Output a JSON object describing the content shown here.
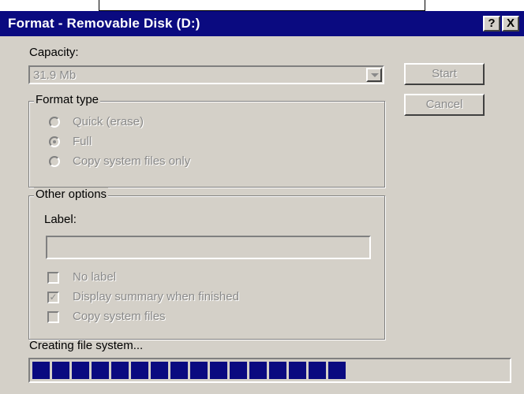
{
  "window": {
    "title": "Format - Removable Disk (D:)",
    "help_button": "?",
    "close_button": "X"
  },
  "capacity": {
    "label": "Capacity:",
    "value": "31.9 Mb"
  },
  "buttons": {
    "start": "Start",
    "cancel": "Cancel"
  },
  "format_type": {
    "title": "Format type",
    "options": [
      {
        "label": "Quick (erase)",
        "selected": false
      },
      {
        "label": "Full",
        "selected": true
      },
      {
        "label": "Copy system files only",
        "selected": false
      }
    ]
  },
  "other_options": {
    "title": "Other options",
    "label_field_label": "Label:",
    "label_value": "",
    "checkboxes": [
      {
        "label": "No label",
        "checked": false
      },
      {
        "label": "Display summary when finished",
        "checked": true
      },
      {
        "label": "Copy system files",
        "checked": false
      }
    ]
  },
  "status": {
    "text": "Creating file system...",
    "progress_fraction": 0.67
  },
  "colors": {
    "titlebar": "#0a0a80",
    "face": "#d4d0c8",
    "progress_block": "#0a0a80",
    "disabled_text": "#8a8a8a"
  }
}
